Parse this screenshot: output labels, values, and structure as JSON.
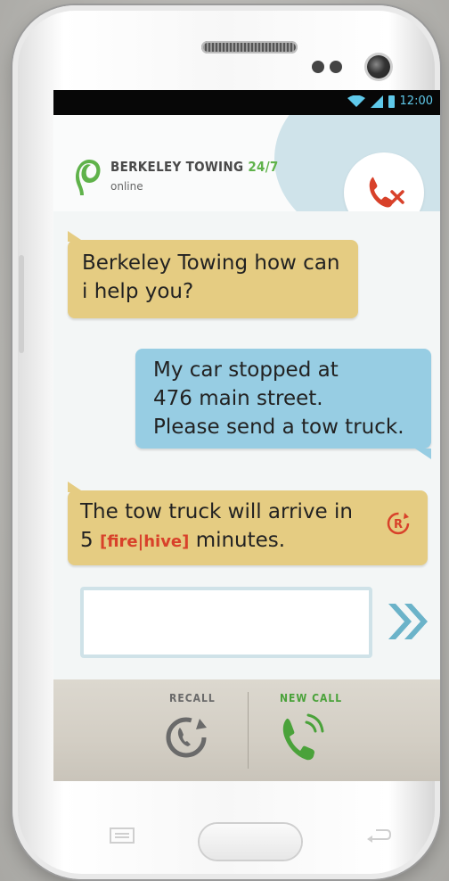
{
  "status_bar": {
    "time": "12:00"
  },
  "header": {
    "title_main": "BERKELEY TOWING ",
    "title_accent": "24/7",
    "status": "online"
  },
  "messages": [
    {
      "from": "agent",
      "text": "Berkeley Towing how can i help you?"
    },
    {
      "from": "user",
      "lines": [
        "My car stopped at",
        "476 main street.",
        "Please send a tow truck."
      ]
    },
    {
      "from": "agent",
      "line1": "The tow truck will arrive in",
      "line2_prefix": "5",
      "tag_open": "[",
      "tag_a": "fire",
      "tag_sep": "|",
      "tag_b": "hive",
      "tag_close": "]",
      "line2_suffix": "minutes."
    }
  ],
  "input": {
    "value": ""
  },
  "bottom_bar": {
    "recall_label": "RECALL",
    "new_call_label": "NEW CALL"
  },
  "colors": {
    "agent_bubble": "#e5cc82",
    "user_bubble": "#97cde3",
    "accent_green": "#5fb24a",
    "end_call_red": "#d8412a",
    "status_blue": "#5fc9ea"
  },
  "icons": [
    "wifi-icon",
    "signal-icon",
    "battery-icon",
    "logo-icon",
    "end-call-icon",
    "retry-icon",
    "send-icon",
    "recall-icon",
    "new-call-icon",
    "menu-icon",
    "back-icon"
  ]
}
